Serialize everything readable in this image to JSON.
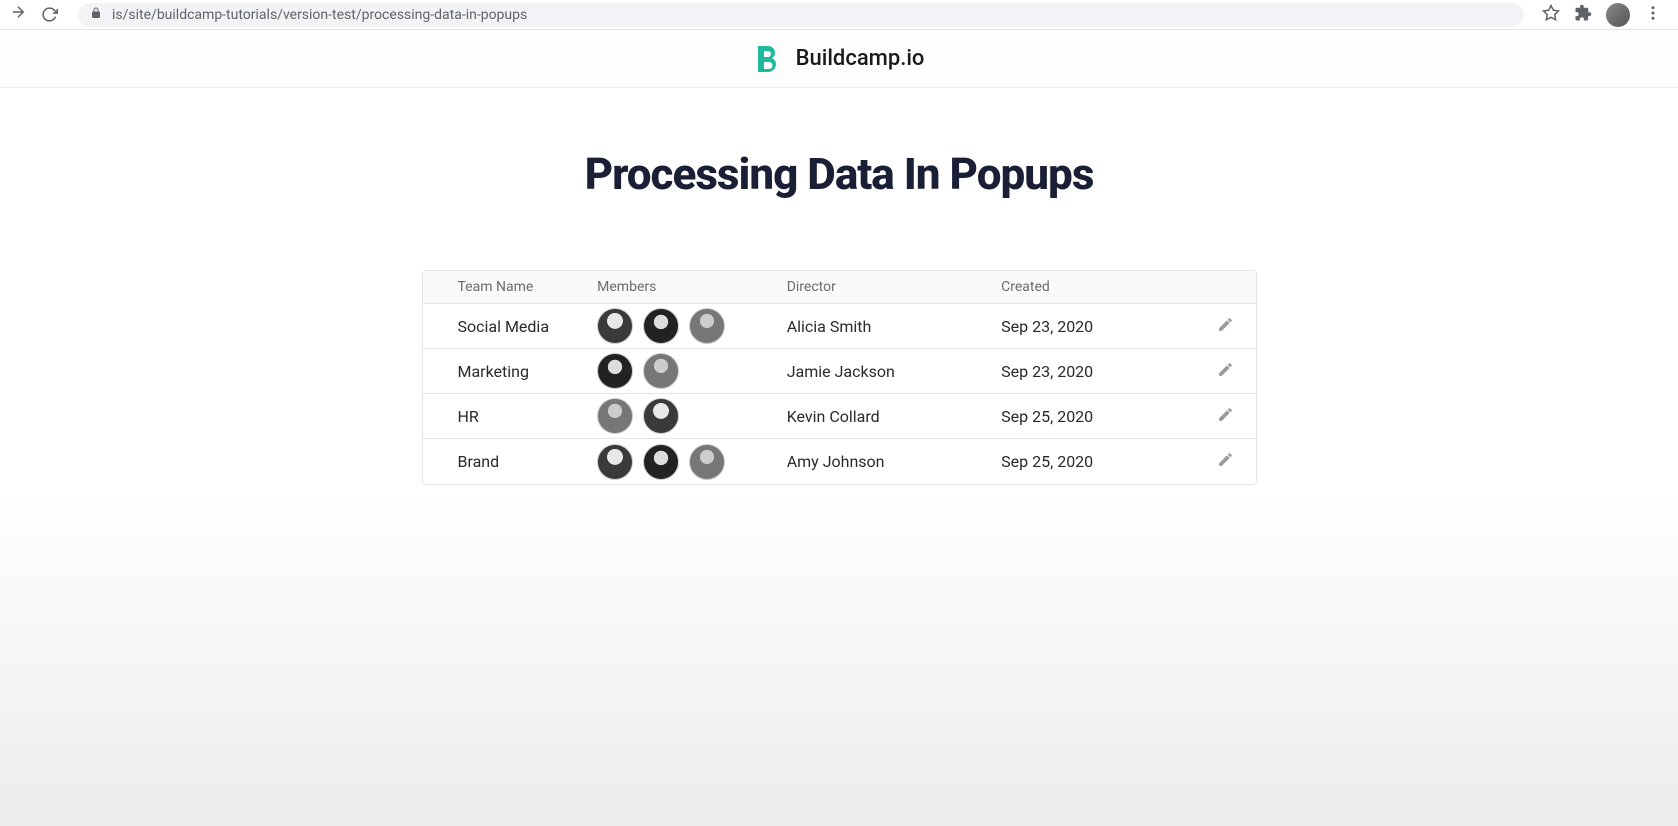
{
  "browser": {
    "url": "is/site/buildcamp-tutorials/version-test/processing-data-in-popups"
  },
  "header": {
    "site_name": "Buildcamp.io"
  },
  "page": {
    "title": "Processing Data In Popups"
  },
  "table": {
    "headers": {
      "team_name": "Team Name",
      "members": "Members",
      "director": "Director",
      "created": "Created"
    },
    "rows": [
      {
        "team_name": "Social Media",
        "member_count": 3,
        "director": "Alicia Smith",
        "created": "Sep 23, 2020"
      },
      {
        "team_name": "Marketing",
        "member_count": 2,
        "director": "Jamie Jackson",
        "created": "Sep 23, 2020"
      },
      {
        "team_name": "HR",
        "member_count": 2,
        "director": "Kevin Collard",
        "created": "Sep 25, 2020"
      },
      {
        "team_name": "Brand",
        "member_count": 3,
        "director": "Amy Johnson",
        "created": "Sep 25, 2020"
      }
    ]
  }
}
